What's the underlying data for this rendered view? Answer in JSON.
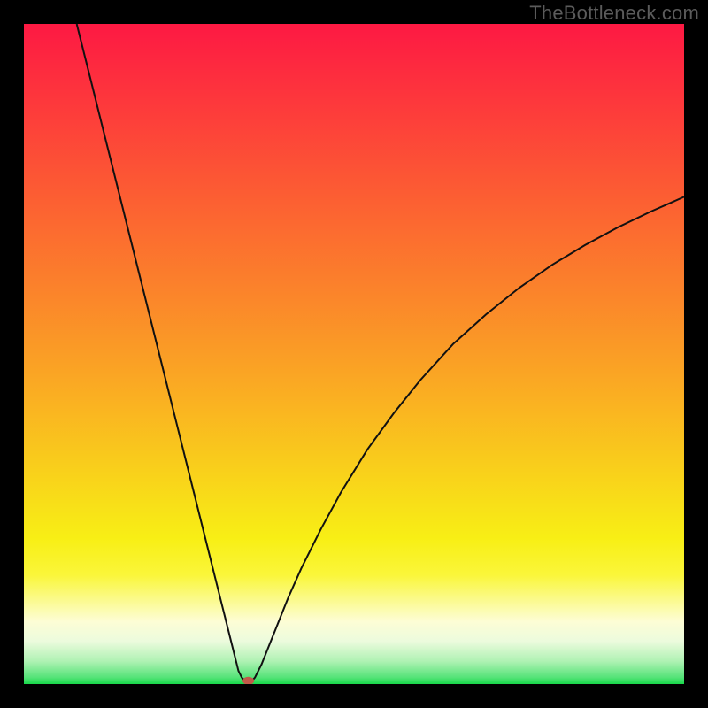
{
  "watermark": "TheBottleneck.com",
  "chart_data": {
    "type": "line",
    "title": "",
    "xlabel": "",
    "ylabel": "",
    "xlim": [
      0,
      100
    ],
    "ylim": [
      0,
      100
    ],
    "grid": false,
    "legend": false,
    "background_gradient": {
      "type": "vertical",
      "stops": [
        {
          "offset": 0.0,
          "color": "#fd1943"
        },
        {
          "offset": 0.13,
          "color": "#fd3b3b"
        },
        {
          "offset": 0.27,
          "color": "#fc6032"
        },
        {
          "offset": 0.4,
          "color": "#fb822b"
        },
        {
          "offset": 0.53,
          "color": "#faa524"
        },
        {
          "offset": 0.66,
          "color": "#f9cb1c"
        },
        {
          "offset": 0.78,
          "color": "#f8ef15"
        },
        {
          "offset": 0.835,
          "color": "#faf63a"
        },
        {
          "offset": 0.87,
          "color": "#fbfa88"
        },
        {
          "offset": 0.905,
          "color": "#fdfdd5"
        },
        {
          "offset": 0.935,
          "color": "#ecfbdd"
        },
        {
          "offset": 0.965,
          "color": "#b0f2b4"
        },
        {
          "offset": 0.99,
          "color": "#55e378"
        },
        {
          "offset": 1.0,
          "color": "#18d94a"
        }
      ]
    },
    "series": [
      {
        "name": "curve",
        "stroke": "#111111",
        "stroke_width": 2,
        "x": [
          8,
          10,
          12,
          14,
          16,
          18,
          20,
          22,
          24,
          26,
          28,
          30,
          32,
          32.5,
          33,
          33.7,
          34.3,
          35,
          36,
          38,
          40,
          42,
          45,
          48,
          52,
          56,
          60,
          65,
          70,
          75,
          80,
          85,
          90,
          95,
          100
        ],
        "y": [
          100,
          92,
          84,
          76,
          68,
          60,
          52,
          44,
          36,
          28,
          20,
          12,
          4,
          2,
          1,
          0.2,
          0.2,
          1,
          3,
          8,
          13,
          17.5,
          23.5,
          29,
          35.5,
          41,
          46,
          51.5,
          56,
          60,
          63.5,
          66.5,
          69.2,
          71.6,
          73.8
        ]
      }
    ],
    "marker": {
      "name": "min-point",
      "x": 34,
      "y": 0.5,
      "color": "#c15a49",
      "rx": 6.5,
      "ry": 4.5
    }
  }
}
